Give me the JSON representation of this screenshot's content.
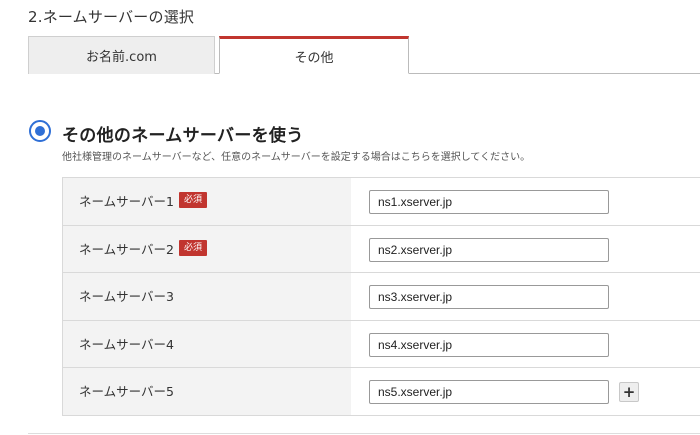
{
  "section_title": "2.ネームサーバーの選択",
  "tabs": [
    {
      "label": "お名前.com",
      "active": false
    },
    {
      "label": "その他",
      "active": true
    }
  ],
  "option": {
    "title": "その他のネームサーバーを使う",
    "description": "他社様管理のネームサーバーなど、任意のネームサーバーを設定する場合はこちらを選択してください。",
    "selected": true
  },
  "required_badge": "必須",
  "nameservers": [
    {
      "label": "ネームサーバー1",
      "value": "ns1.xserver.jp",
      "required": true
    },
    {
      "label": "ネームサーバー2",
      "value": "ns2.xserver.jp",
      "required": true
    },
    {
      "label": "ネームサーバー3",
      "value": "ns3.xserver.jp",
      "required": false
    },
    {
      "label": "ネームサーバー4",
      "value": "ns4.xserver.jp",
      "required": false
    },
    {
      "label": "ネームサーバー5",
      "value": "ns5.xserver.jp",
      "required": false
    }
  ],
  "add_button": {
    "icon": "plus-icon"
  },
  "colors": {
    "accent_blue": "#2f6fd6",
    "accent_red": "#c1352f"
  }
}
